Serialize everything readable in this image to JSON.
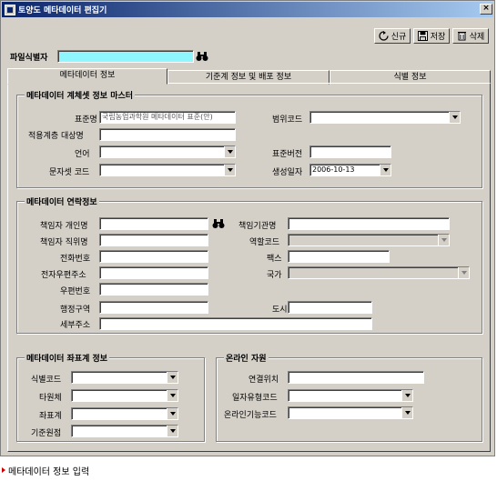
{
  "window": {
    "title": "토양도 메타데이터 편집기"
  },
  "toolbar": {
    "new_label": "신규",
    "save_label": "저장",
    "delete_label": "삭제"
  },
  "file_id": {
    "label": "파일식별자",
    "value": ""
  },
  "tabs": [
    {
      "label": "메타데이터 정보"
    },
    {
      "label": "기준계 정보 및 배포 정보"
    },
    {
      "label": "식별 정보"
    }
  ],
  "master": {
    "title": "메타데이터 계체셋 정보 마스터",
    "standard_name_label": "표준명",
    "standard_name_value": "국립농업과학원 메타데이터 표준(안)",
    "scope_code_label": "범위코드",
    "applied_level_label": "적용계층 대상명",
    "language_label": "언어",
    "standard_version_label": "표준버전",
    "charset_label": "문자셋 코드",
    "date_label": "생성일자",
    "date_value": "2006-10-13"
  },
  "contact": {
    "title": "메타데이터 연락정보",
    "person_label": "책임자 개인명",
    "org_label": "책임기관명",
    "position_label": "책임자 직위명",
    "role_label": "역할코드",
    "phone_label": "전화번호",
    "fax_label": "팩스",
    "email_label": "전자우편주소",
    "country_label": "국가",
    "postal_label": "우편번호",
    "admin_area_label": "행정구역",
    "city_label": "도시",
    "address_label": "세부주소"
  },
  "coord": {
    "title": "메타데이터 좌표계 정보",
    "id_code_label": "식별코드",
    "ellipsoid_label": "타원체",
    "coord_system_label": "좌표계",
    "datum_label": "기준원점"
  },
  "online": {
    "title": "온라인 자원",
    "link_label": "연결위치",
    "protocol_label": "일자유형코드",
    "function_label": "온라인기능코드"
  },
  "status": {
    "text": "메타데이터 정보 입력"
  }
}
